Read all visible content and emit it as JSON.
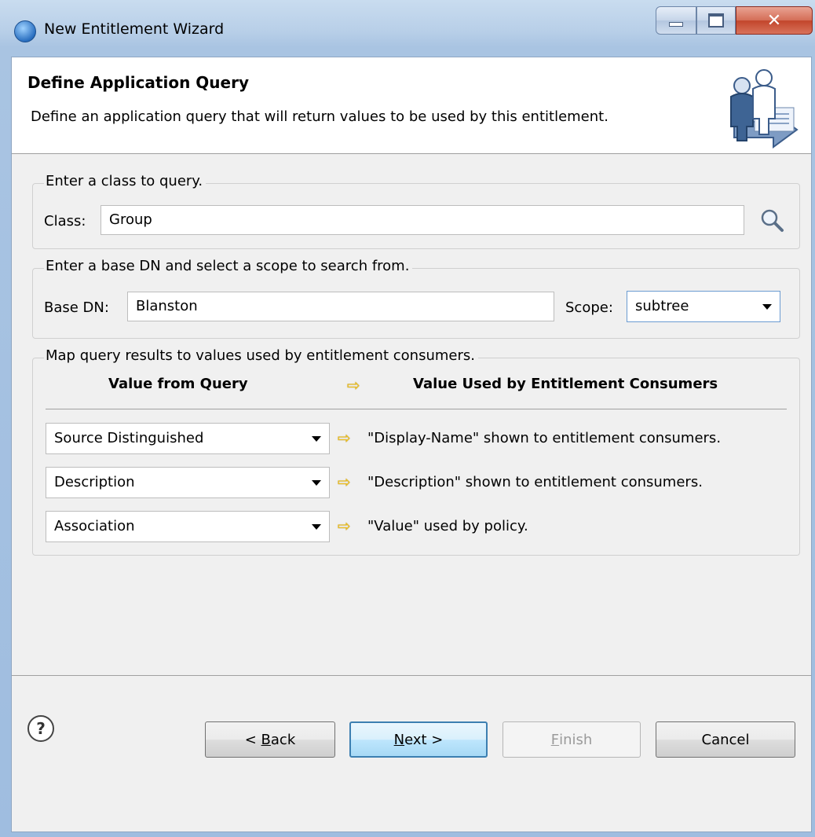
{
  "window": {
    "title": "New Entitlement Wizard"
  },
  "header": {
    "title": "Define Application Query",
    "description": "Define an application query that will return values to be used by this entitlement."
  },
  "class_group": {
    "legend": "Enter a class to query.",
    "label": "Class:",
    "value": "Group",
    "search_icon": "magnifier-icon"
  },
  "dn_group": {
    "legend": "Enter a base DN and select a scope to search from.",
    "base_dn_label": "Base DN:",
    "base_dn_value": "Blanston",
    "scope_label": "Scope:",
    "scope_value": "subtree"
  },
  "map_group": {
    "legend": "Map query results to values used by entitlement consumers.",
    "col_from": "Value from Query",
    "col_to": "Value Used by Entitlement Consumers",
    "rows": [
      {
        "from": "Source Distinguished",
        "to": "\"Display-Name\" shown to entitlement consumers."
      },
      {
        "from": "Description",
        "to": "\"Description\" shown to entitlement consumers."
      },
      {
        "from": "Association",
        "to": "\"Value\" used by policy."
      }
    ]
  },
  "buttons": {
    "help": "?",
    "back_prefix": "< ",
    "back_mnemonic": "B",
    "back_rest": "ack",
    "next_mnemonic": "N",
    "next_rest": "ext >",
    "finish_mnemonic": "F",
    "finish_rest": "inish",
    "cancel": "Cancel"
  },
  "colors": {
    "arrow": "#f2c21b",
    "default_button_border": "#3c7fb1"
  }
}
